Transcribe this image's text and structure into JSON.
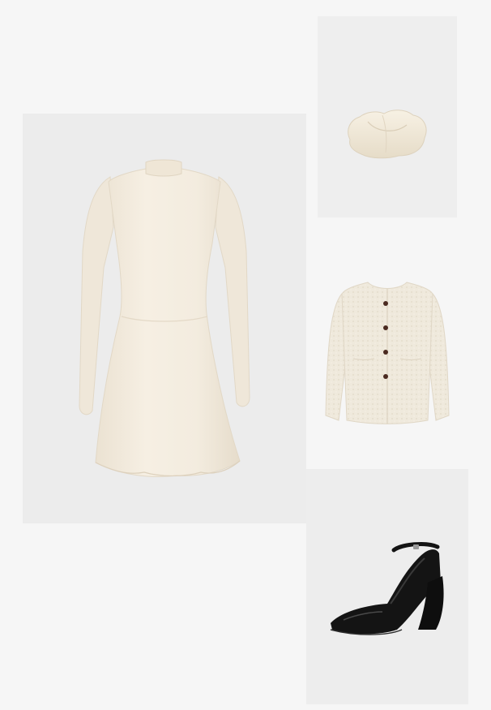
{
  "outfit": {
    "items": [
      {
        "item": "dress",
        "color": "#f3ecdf"
      },
      {
        "item": "bag",
        "color": "#f1ead8"
      },
      {
        "item": "jacket",
        "color": "#efe9dc"
      },
      {
        "item": "shoe",
        "color": "#141414"
      }
    ],
    "background": "#f6f6f6",
    "tile_color": "#ececec"
  }
}
